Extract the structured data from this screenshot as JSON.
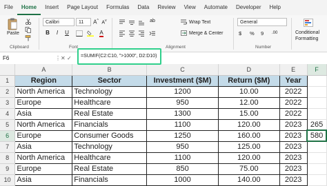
{
  "ribbon_tabs": [
    "File",
    "Home",
    "Insert",
    "Page Layout",
    "Formulas",
    "Data",
    "Review",
    "View",
    "Automate",
    "Developer",
    "Help"
  ],
  "active_tab_index": 1,
  "accent_color": "#1e7145",
  "clipboard": {
    "paste": "Paste",
    "label": "Clipboard"
  },
  "font": {
    "name": "Calibri",
    "size": "11",
    "label": "Font"
  },
  "alignment": {
    "wrap_text": "Wrap Text",
    "merge_center": "Merge & Center",
    "label": "Alignment"
  },
  "number": {
    "format": "General",
    "currency": "$",
    "percent": "%",
    "comma": "9",
    "label": "Number"
  },
  "styles": {
    "conditional": "Conditional",
    "formatting": "Formatting"
  },
  "formula_bar": {
    "name_box": "F6",
    "formula": "=SUMIF(C2:C10, \">1000\", D2:D10)"
  },
  "columns": [
    "A",
    "B",
    "C",
    "D",
    "E",
    "F"
  ],
  "headers": [
    "Region",
    "Sector",
    "Investment ($M)",
    "Return ($M)",
    "Year"
  ],
  "rows": [
    {
      "num": "1"
    },
    {
      "num": "2",
      "cells": [
        "North America",
        "Technology",
        "1200",
        "10.00",
        "2022"
      ]
    },
    {
      "num": "3",
      "cells": [
        "Europe",
        "Healthcare",
        "950",
        "12.00",
        "2022"
      ]
    },
    {
      "num": "4",
      "cells": [
        "Asia",
        "Real Estate",
        "1300",
        "15.00",
        "2022"
      ]
    },
    {
      "num": "5",
      "cells": [
        "North America",
        "Financials",
        "1100",
        "120.00",
        "2023"
      ],
      "f": "265"
    },
    {
      "num": "6",
      "cells": [
        "Europe",
        "Consumer Goods",
        "1250",
        "160.00",
        "2023"
      ],
      "f": "580"
    },
    {
      "num": "7",
      "cells": [
        "Asia",
        "Technology",
        "950",
        "125.00",
        "2023"
      ]
    },
    {
      "num": "8",
      "cells": [
        "North America",
        "Healthcare",
        "1100",
        "120.00",
        "2023"
      ]
    },
    {
      "num": "9",
      "cells": [
        "Europe",
        "Real Estate",
        "850",
        "75.00",
        "2023"
      ]
    },
    {
      "num": "10",
      "cells": [
        "Asia",
        "Financials",
        "1000",
        "140.00",
        "2023"
      ]
    }
  ]
}
